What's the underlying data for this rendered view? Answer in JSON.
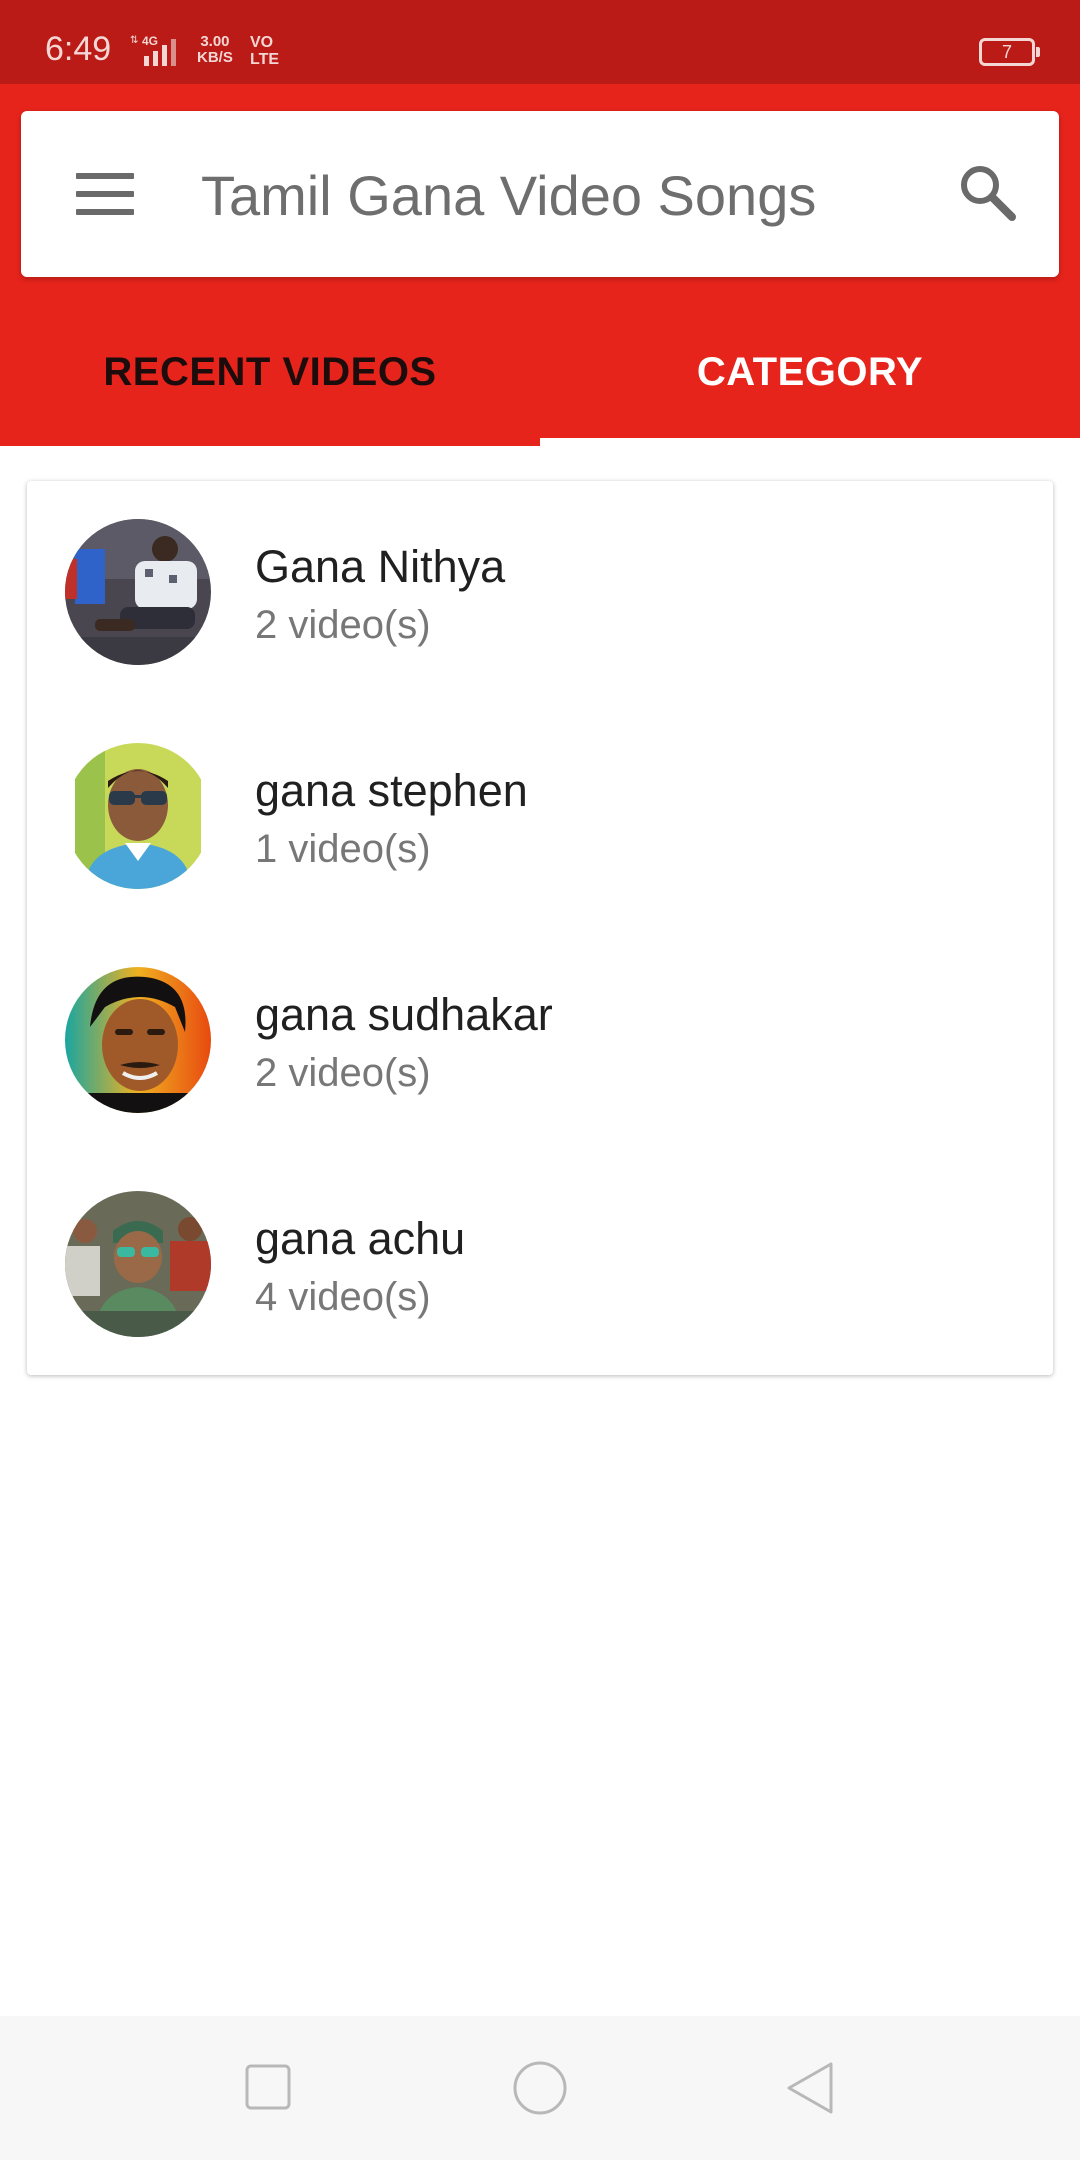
{
  "status_bar": {
    "time": "6:49",
    "network_type": "4G",
    "speed_value": "3.00",
    "speed_unit": "KB/S",
    "volte_top": "VO",
    "volte_bottom": "LTE",
    "battery": "7"
  },
  "header": {
    "title": "Tamil Gana Video Songs",
    "menu_icon": "hamburger-menu-icon",
    "search_icon": "search-icon"
  },
  "tabs": [
    {
      "label": "RECENT VIDEOS",
      "selected": false
    },
    {
      "label": "CATEGORY",
      "selected": true
    }
  ],
  "categories": [
    {
      "name": "Gana Nithya",
      "count": "2 video(s)"
    },
    {
      "name": "gana stephen",
      "count": "1 video(s)"
    },
    {
      "name": "gana sudhakar",
      "count": "2 video(s)"
    },
    {
      "name": "gana achu",
      "count": "4 video(s)"
    }
  ],
  "nav_bar": {
    "buttons": [
      "recents-icon",
      "home-icon",
      "back-icon"
    ]
  },
  "colors": {
    "status_bar": "#ba1b16",
    "accent": "#e7241c",
    "tab_inactive_text": "#1d0c0c",
    "tab_active_text": "#ffffff"
  }
}
